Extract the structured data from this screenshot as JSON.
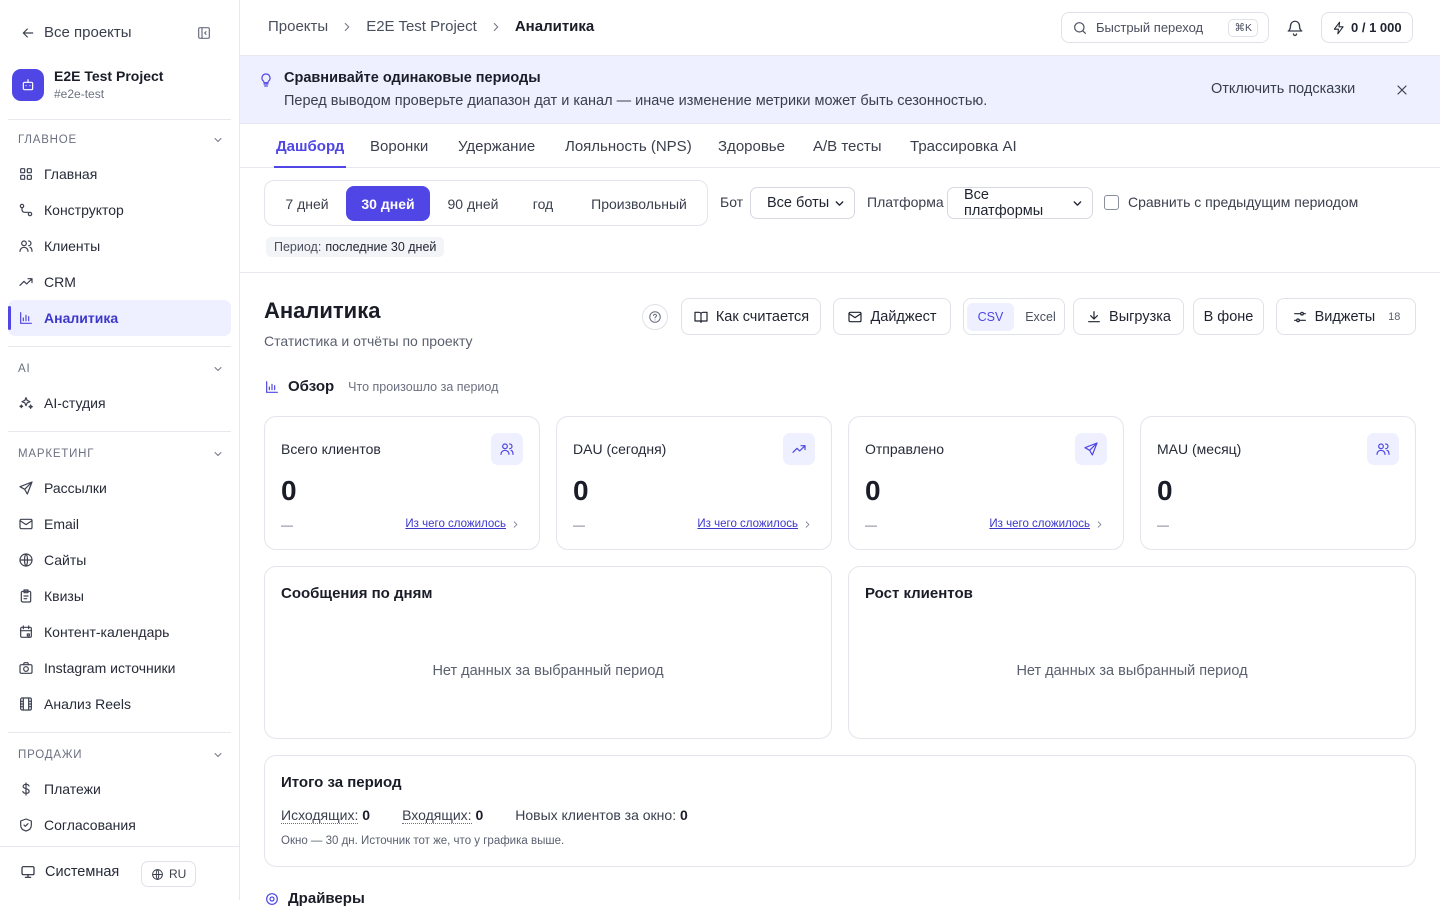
{
  "sidebar": {
    "back_label": "Все проекты",
    "project": {
      "name": "E2E Test Project",
      "slug": "#e2e-test"
    },
    "sections": [
      {
        "title": "ГЛАВНОЕ",
        "items": [
          {
            "label": "Главная",
            "icon": "grid-icon"
          },
          {
            "label": "Конструктор",
            "icon": "workflow-icon"
          },
          {
            "label": "Клиенты",
            "icon": "users-icon"
          },
          {
            "label": "CRM",
            "icon": "trend-icon"
          },
          {
            "label": "Аналитика",
            "icon": "bar-chart-icon",
            "active": true
          }
        ]
      },
      {
        "title": "AI",
        "items": [
          {
            "label": "AI-студия",
            "icon": "sparkles-icon"
          }
        ]
      },
      {
        "title": "МАРКЕТИНГ",
        "items": [
          {
            "label": "Рассылки",
            "icon": "send-icon"
          },
          {
            "label": "Email",
            "icon": "mail-icon"
          },
          {
            "label": "Сайты",
            "icon": "globe-icon"
          },
          {
            "label": "Квизы",
            "icon": "clipboard-icon"
          },
          {
            "label": "Контент-календарь",
            "icon": "calendar-icon"
          },
          {
            "label": "Instagram источники",
            "icon": "camera-icon"
          },
          {
            "label": "Анализ Reels",
            "icon": "film-icon"
          }
        ]
      },
      {
        "title": "ПРОДАЖИ",
        "items": [
          {
            "label": "Платежи",
            "icon": "dollar-icon"
          },
          {
            "label": "Согласования",
            "icon": "shield-check-icon"
          }
        ]
      }
    ],
    "theme_label": "Системная",
    "lang_label": "RU"
  },
  "topbar": {
    "breadcrumbs": [
      "Проекты",
      "E2E Test Project",
      "Аналитика"
    ],
    "search_label": "Быстрый переход",
    "search_shortcut": "⌘K",
    "credits": "0 / 1 000"
  },
  "hint": {
    "title": "Сравнивайте одинаковые периоды",
    "text": "Перед выводом проверьте диапазон дат и канал — иначе изменение метрики может быть сезонностью.",
    "disable_label": "Отключить подсказки"
  },
  "tabs": [
    "Дашборд",
    "Воронки",
    "Удержание",
    "Лояльность (NPS)",
    "Здоровье",
    "A/B тесты",
    "Трассировка AI"
  ],
  "active_tab": 0,
  "filters": {
    "periods": [
      "7 дней",
      "30 дней",
      "90 дней",
      "год",
      "Произвольный"
    ],
    "active_period": 1,
    "bot_label": "Бот",
    "bot_value": "Все боты",
    "platform_label": "Платформа",
    "platform_value": "Все платформы",
    "compare_label": "Сравнить с предыдущим периодом",
    "compare_checked": false,
    "period_caption": "Период:",
    "period_value": "последние 30 дней"
  },
  "header": {
    "title": "Аналитика",
    "subtitle": "Статистика и отчёты по проекту",
    "how_label": "Как считается",
    "digest_label": "Дайджест",
    "format_csv": "CSV",
    "format_excel": "Excel",
    "export_label": "Выгрузка",
    "background_label": "В фоне",
    "widgets_label": "Виджеты",
    "widgets_count": "18"
  },
  "overview": {
    "title": "Обзор",
    "subtitle": "Что произошло за период"
  },
  "kpis": [
    {
      "title": "Всего клиентов",
      "value": "0",
      "delta": "—",
      "link": "Из чего сложилось",
      "icon": "users-icon"
    },
    {
      "title": "DAU (сегодня)",
      "value": "0",
      "delta": "—",
      "link": "Из чего сложилось",
      "icon": "trend-icon"
    },
    {
      "title": "Отправлено",
      "value": "0",
      "delta": "—",
      "link": "Из чего сложилось",
      "icon": "send-icon"
    },
    {
      "title": "MAU (месяц)",
      "value": "0",
      "delta": "—",
      "link": "",
      "icon": "users-icon"
    }
  ],
  "charts": [
    {
      "title": "Сообщения по дням",
      "empty": "Нет данных за выбранный период"
    },
    {
      "title": "Рост клиентов",
      "empty": "Нет данных за выбранный период"
    }
  ],
  "summary": {
    "title": "Итого за период",
    "items": [
      {
        "label": "Исходящих:",
        "value": "0"
      },
      {
        "label": "Входящих:",
        "value": "0"
      },
      {
        "label": "Новых клиентов за окно:",
        "value": "0"
      }
    ],
    "note": "Окно — 30 дн. Источник тот же, что у графика выше."
  },
  "next_section": {
    "title": "Драйверы"
  },
  "colors": {
    "accent": "#4f46e5",
    "accent_bg": "#eef0ff",
    "hint_bg": "#eef0ff"
  }
}
